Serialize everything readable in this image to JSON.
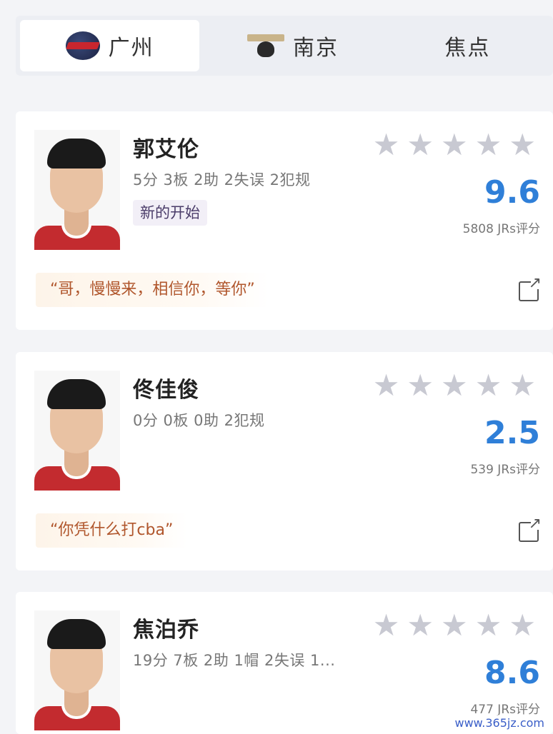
{
  "tabs": [
    {
      "label": "广州",
      "icon": "guangzhou-team-logo-icon",
      "active": true
    },
    {
      "label": "南京",
      "icon": "nanjing-team-logo-icon",
      "active": false
    },
    {
      "label": "焦点",
      "icon": "",
      "active": false
    }
  ],
  "players": [
    {
      "name": "郭艾伦",
      "stats": "5分 3板 2助 2失误 2犯规",
      "tag": "新的开始",
      "stars": 5,
      "score": "9.6",
      "count": "5808 JRs评分",
      "quote": "“哥，慢慢来，相信你，等你”"
    },
    {
      "name": "佟佳俊",
      "stats": "0分 0板 0助 2犯规",
      "tag": "",
      "stars": 5,
      "score": "2.5",
      "count": "539 JRs评分",
      "quote": "“你凭什么打cba”"
    },
    {
      "name": "焦泊乔",
      "stats": "19分 7板 2助 1帽 2失误 1...",
      "tag": "",
      "stars": 5,
      "score": "8.6",
      "count": "477 JRs评分",
      "quote": ""
    }
  ],
  "watermark": "www.365jz.com",
  "colors": {
    "accent": "#2f7fd8",
    "star": "#c8c9d2",
    "quote_text": "#b0562c"
  }
}
